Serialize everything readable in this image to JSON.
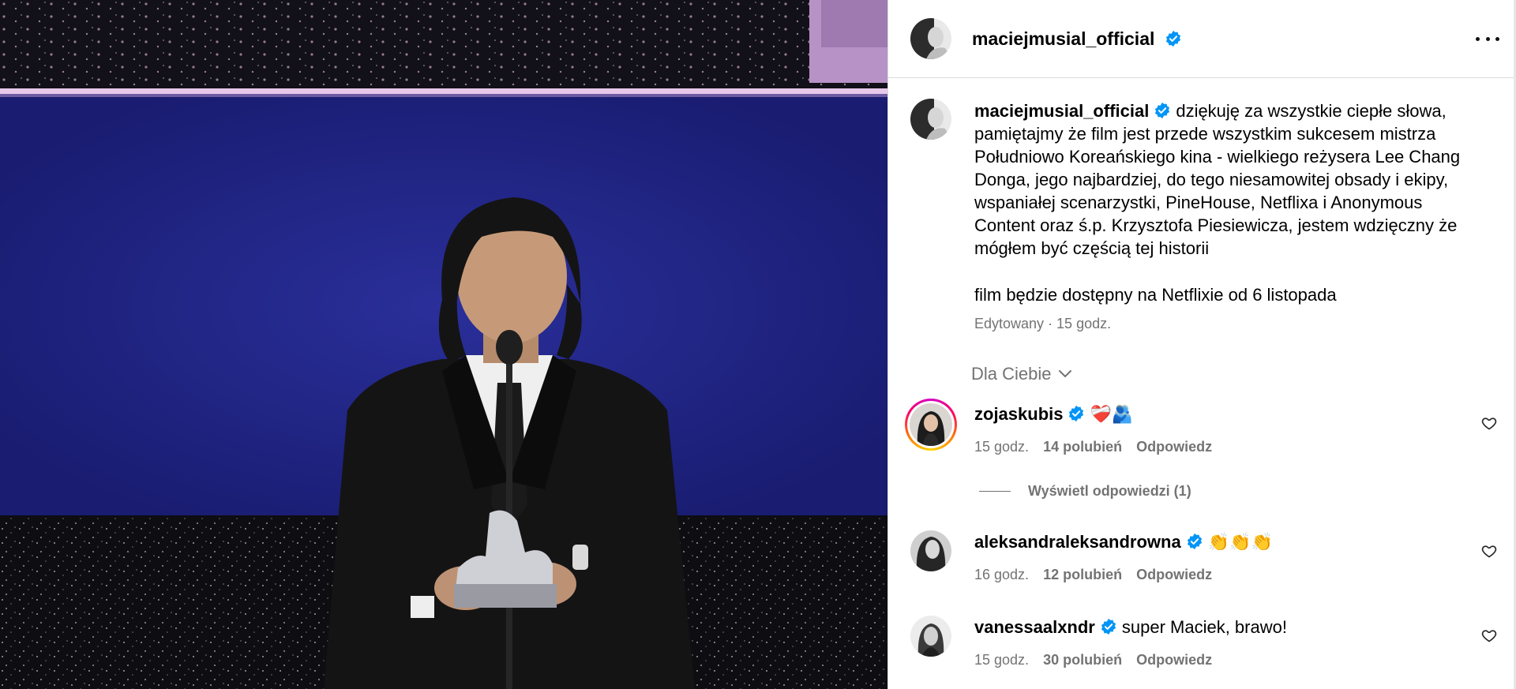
{
  "post": {
    "author": "maciejmusial_official",
    "caption": "dziękuję za wszystkie ciepłe słowa, pamiętajmy że film jest przede wszystkim sukcesem mistrza Południowo Koreańskiego kina - wielkiego reżysera Lee Chang Donga, jego najbardziej, do tego niesamowitej obsady i ekipy, wspaniałej scenarzystki, PineHouse, Netflixa i Anonymous Content oraz ś.p. Krzysztofa Piesiewicza, jestem wdzięczny że mógłem być częścią tej historii",
    "caption_line2": "film będzie dostępny na Netflixie od 6 listopada",
    "meta": "Edytowany · 15 godz."
  },
  "filter_label": "Dla Ciebie",
  "comments": [
    {
      "user": "zojaskubis",
      "text": "❤️‍🩹🫂",
      "time": "15 godz.",
      "likes": "14 polubień",
      "reply": "Odpowiedz"
    },
    {
      "user": "aleksandraleksandrowna",
      "text": "👏👏👏",
      "time": "16 godz.",
      "likes": "12 polubień",
      "reply": "Odpowiedz"
    },
    {
      "user": "vanessaalxndr",
      "text": "super Maciek, brawo!",
      "time": "15 godz.",
      "likes": "30 polubień",
      "reply": "Odpowiedz"
    }
  ],
  "view_replies": "Wyświetl odpowiedzi (1)",
  "icons": {
    "verified": "verified-badge-icon",
    "more": "more-options-icon",
    "like": "heart-icon",
    "chevron": "chevron-down-icon"
  },
  "colors": {
    "verified": "#0095f6",
    "muted": "#737373",
    "stage_blue": "#1b1e7a"
  }
}
